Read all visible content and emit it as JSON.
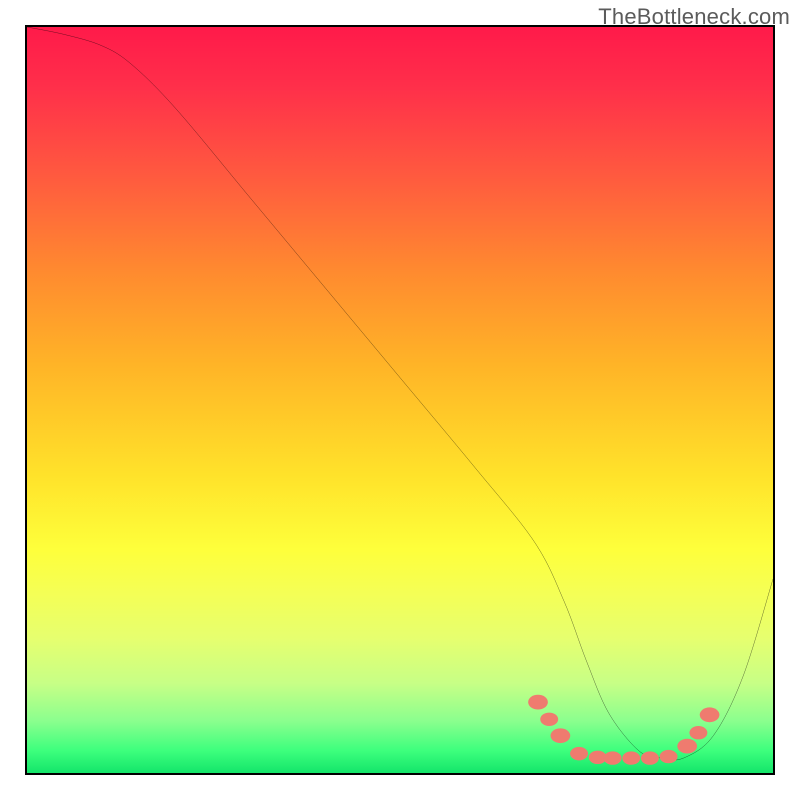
{
  "watermark": "TheBottleneck.com",
  "chart_data": {
    "type": "line",
    "title": "",
    "xlabel": "",
    "ylabel": "",
    "xlim": [
      0,
      100
    ],
    "ylim": [
      0,
      100
    ],
    "series": [
      {
        "name": "curve",
        "color": "#000000",
        "x": [
          0,
          5,
          10,
          14,
          20,
          30,
          40,
          50,
          60,
          68,
          72,
          75,
          78,
          82,
          85,
          88,
          92,
          96,
          100
        ],
        "y": [
          100,
          99,
          97.5,
          95,
          89,
          77,
          65,
          53,
          41,
          31,
          23,
          15,
          8,
          3,
          2,
          2,
          5,
          13,
          26
        ]
      }
    ],
    "markers": {
      "name": "valley-dots",
      "color": "#ef7b6f",
      "points": [
        {
          "x": 68.5,
          "y": 9.5,
          "r": 1.1
        },
        {
          "x": 70.0,
          "y": 7.2,
          "r": 1.0
        },
        {
          "x": 71.5,
          "y": 5.0,
          "r": 1.1
        },
        {
          "x": 74.0,
          "y": 2.6,
          "r": 1.0
        },
        {
          "x": 76.5,
          "y": 2.1,
          "r": 1.0
        },
        {
          "x": 78.5,
          "y": 2.0,
          "r": 1.0
        },
        {
          "x": 81.0,
          "y": 2.0,
          "r": 1.0
        },
        {
          "x": 83.5,
          "y": 2.0,
          "r": 1.0
        },
        {
          "x": 86.0,
          "y": 2.2,
          "r": 1.0
        },
        {
          "x": 88.5,
          "y": 3.6,
          "r": 1.1
        },
        {
          "x": 90.0,
          "y": 5.4,
          "r": 1.0
        },
        {
          "x": 91.5,
          "y": 7.8,
          "r": 1.1
        }
      ]
    }
  }
}
